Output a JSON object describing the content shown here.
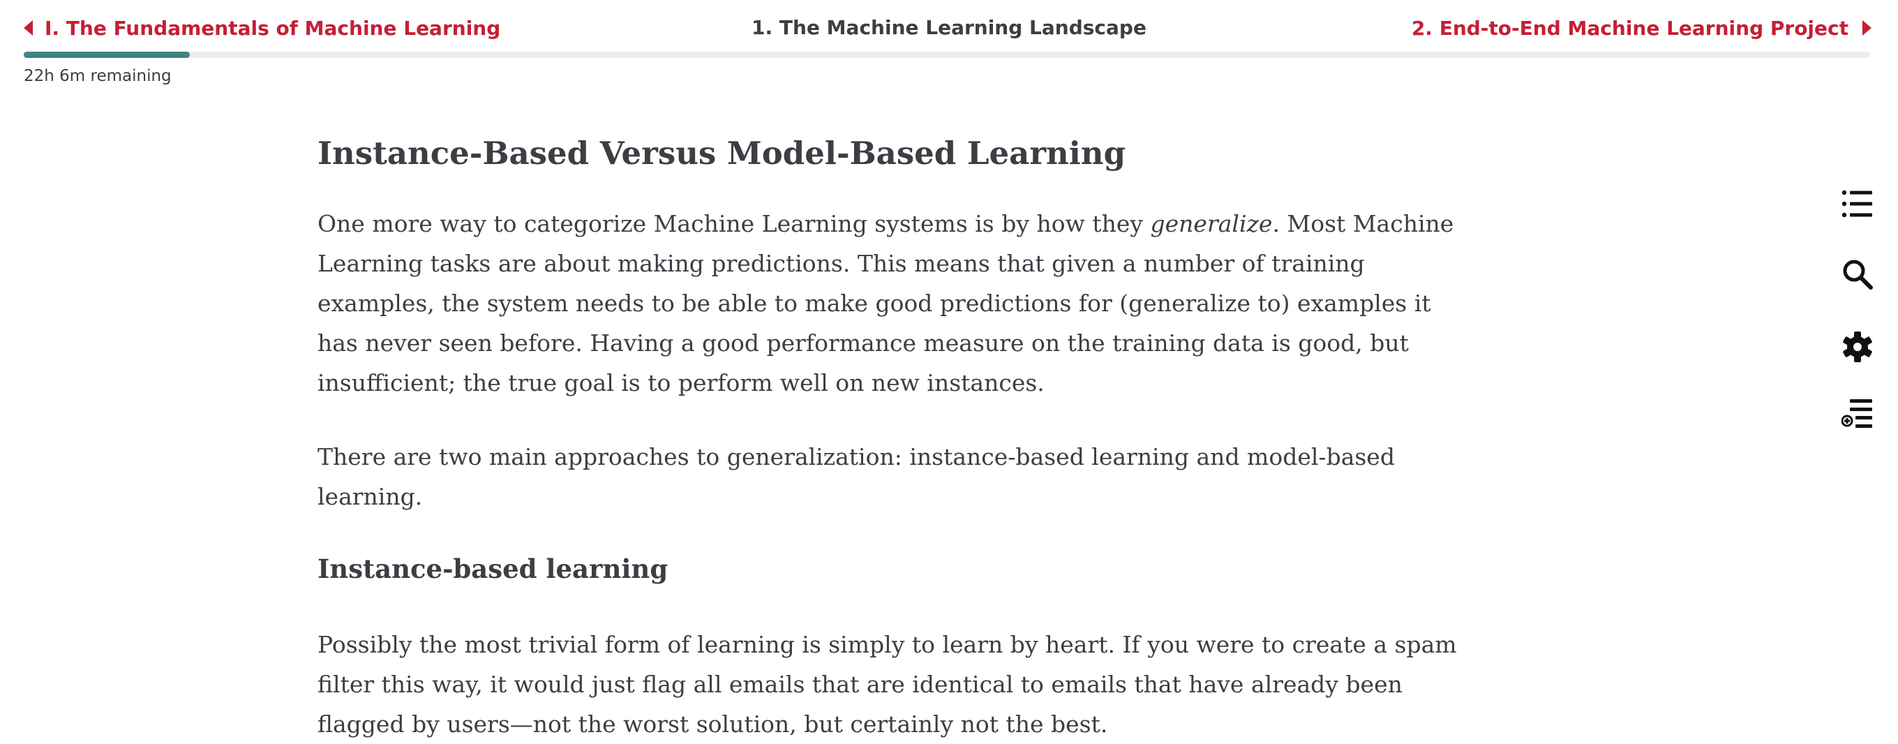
{
  "nav": {
    "prev_label": "I. The Fundamentals of Machine Learning",
    "current_title": "1. The Machine Learning Landscape",
    "next_label": "2. End-to-End Machine Learning Project",
    "progress_fraction": 0.09,
    "remaining": "22h 6m remaining"
  },
  "article": {
    "heading": "Instance-Based Versus Model-Based Learning",
    "p1_before": "One more way to categorize Machine Learning systems is by how they ",
    "p1_em": "generalize",
    "p1_after": ". Most Machine Learning tasks are about making predictions. This means that given a number of training examples, the system needs to be able to make good predictions for (generalize to) examples it has never seen before. Having a good performance measure on the training data is good, but insufficient; the true goal is to perform well on new instances.",
    "p2": "There are two main approaches to generalization: instance-based learning and model-based learning.",
    "subheading": "Instance-based learning",
    "p3": "Possibly the most trivial form of learning is simply to learn by heart. If you were to create a spam filter this way, it would just flag all emails that are identical to emails that have already been flagged by users—not the worst solution, but certainly not the best."
  },
  "sidebar_icons": [
    "table-of-contents-icon",
    "search-icon",
    "settings-gear-icon",
    "add-to-playlist-icon"
  ],
  "colors": {
    "accent_red": "#c51f34",
    "progress_teal": "#3e8583",
    "text": "#3d3d44"
  }
}
